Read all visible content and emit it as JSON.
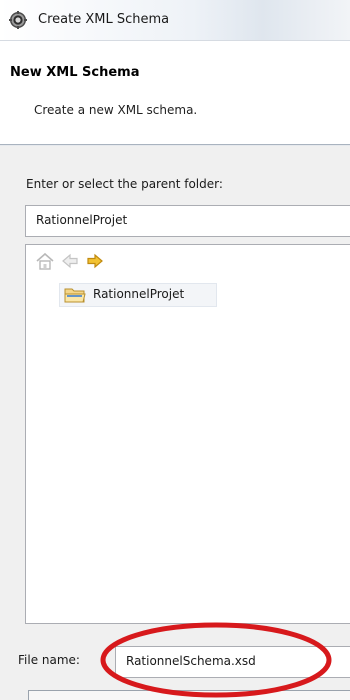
{
  "window": {
    "title": "Create XML Schema",
    "title_icon": "gear-icon"
  },
  "banner": {
    "title": "New XML Schema",
    "description": "Create a new XML schema."
  },
  "parent_folder": {
    "label": "Enter or select the parent folder:",
    "value": "RationnelProjet"
  },
  "tree": {
    "toolbar": [
      {
        "icon": "home-icon"
      },
      {
        "icon": "back-arrow-icon"
      },
      {
        "icon": "forward-arrow-icon"
      }
    ],
    "items": [
      {
        "label": "RationnelProjet",
        "icon": "folder-icon"
      }
    ]
  },
  "file_name": {
    "label": "File name:",
    "value": "RationnelSchema.xsd"
  },
  "colors": {
    "annotation_ellipse": "#d7191c",
    "forward_arrow": "#f2c232",
    "folder": "#3f7fd0"
  }
}
